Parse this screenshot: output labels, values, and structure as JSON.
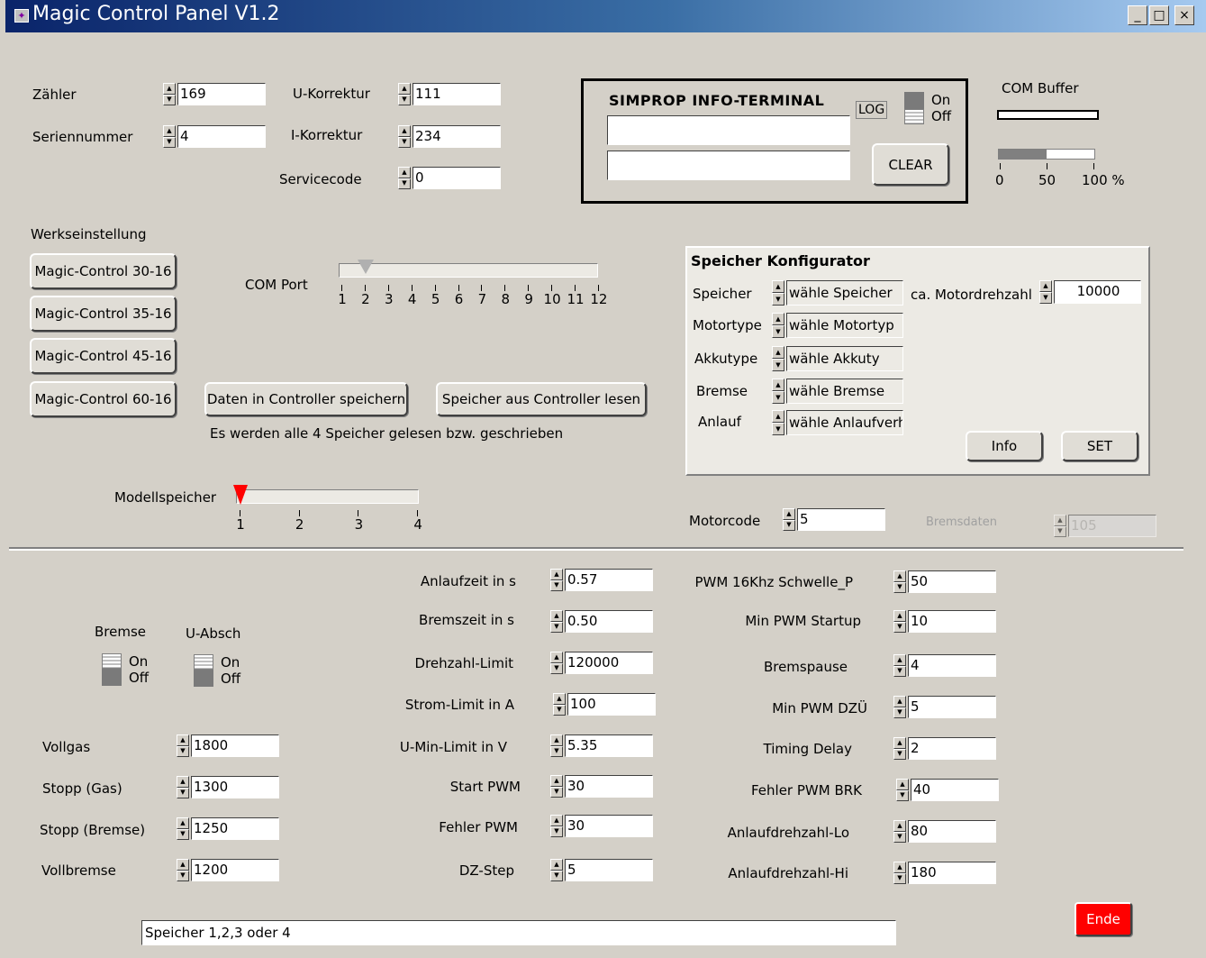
{
  "window": {
    "title": "Magic Control Panel V1.2",
    "minimize": "_",
    "maximize": "□",
    "close": "×"
  },
  "top_fields": {
    "zaehler": {
      "label": "Zähler",
      "value": "169"
    },
    "seriennummer": {
      "label": "Seriennummer",
      "value": "4"
    },
    "u_korrektur": {
      "label": "U-Korrektur",
      "value": "111"
    },
    "i_korrektur": {
      "label": "I-Korrektur",
      "value": "234"
    },
    "servicecode": {
      "label": "Servicecode",
      "value": "0"
    }
  },
  "terminal": {
    "title": "SIMPROP INFO-TERMINAL",
    "log_label": "LOG",
    "on": "On",
    "off": "Off",
    "clear": "CLEAR"
  },
  "com_buffer": {
    "label": "COM Buffer",
    "ticks": [
      "0",
      "50",
      "100 %"
    ],
    "level_percent": 50
  },
  "werkseinstellung": {
    "label": "Werkseinstellung",
    "buttons": [
      "Magic-Control 30-16",
      "Magic-Control 35-16",
      "Magic-Control 45-16",
      "Magic-Control 60-16"
    ]
  },
  "com_port": {
    "label": "COM Port",
    "ticks": [
      "1",
      "2",
      "3",
      "4",
      "5",
      "6",
      "7",
      "8",
      "9",
      "10",
      "11",
      "12"
    ],
    "value": 2
  },
  "actions": {
    "save": "Daten in Controller speichern",
    "read": "Speicher aus Controller lesen",
    "note": "Es werden alle 4 Speicher gelesen bzw. geschrieben"
  },
  "modellspeicher": {
    "label": "Modellspeicher",
    "ticks": [
      "1",
      "2",
      "3",
      "4"
    ],
    "value": 1
  },
  "speicher_konfigurator": {
    "title": "Speicher Konfigurator",
    "rows": [
      {
        "label": "Speicher",
        "value": "wähle Speicher"
      },
      {
        "label": "Motortype",
        "value": "wähle Motortyp"
      },
      {
        "label": "Akkutype",
        "value": "wähle Akkuty"
      },
      {
        "label": "Bremse",
        "value": "wähle Bremse"
      },
      {
        "label": "Anlauf",
        "value": "wähle Anlaufverh"
      }
    ],
    "motordrehzahl_label": "ca. Motordrehzahl",
    "motordrehzahl_value": "10000",
    "info": "Info",
    "set": "SET"
  },
  "motorcode": {
    "label": "Motorcode",
    "value": "5"
  },
  "bremsdaten": {
    "label": "Bremsdaten",
    "value": "105"
  },
  "toggles": {
    "bremse": {
      "label": "Bremse",
      "on": "On",
      "off": "Off"
    },
    "u_absch": {
      "label": "U-Absch",
      "on": "On",
      "off": "Off"
    }
  },
  "left_params": [
    {
      "label": "Vollgas",
      "value": "1800"
    },
    {
      "label": "Stopp (Gas)",
      "value": "1300"
    },
    {
      "label": "Stopp (Bremse)",
      "value": "1250"
    },
    {
      "label": "Vollbremse",
      "value": "1200"
    }
  ],
  "middle_params": [
    {
      "label": "Anlaufzeit  in s",
      "value": "0.57"
    },
    {
      "label": "Bremszeit in s",
      "value": "0.50"
    },
    {
      "label": "Drehzahl-Limit",
      "value": "120000"
    },
    {
      "label": "Strom-Limit in A",
      "value": "100"
    },
    {
      "label": "U-Min-Limit  in V",
      "value": "5.35"
    },
    {
      "label": "Start PWM",
      "value": "30"
    },
    {
      "label": "Fehler PWM",
      "value": "30"
    },
    {
      "label": "DZ-Step",
      "value": "5"
    }
  ],
  "right_params": [
    {
      "label": "PWM 16Khz Schwelle_P",
      "value": "50"
    },
    {
      "label": "Min PWM Startup",
      "value": "10"
    },
    {
      "label": "Bremspause",
      "value": "4"
    },
    {
      "label": "Min PWM DZÜ",
      "value": "5"
    },
    {
      "label": "Timing Delay",
      "value": "2"
    },
    {
      "label": "Fehler PWM BRK",
      "value": "40"
    },
    {
      "label": "Anlaufdrehzahl-Lo",
      "value": "80"
    },
    {
      "label": "Anlaufdrehzahl-Hi",
      "value": "180"
    }
  ],
  "status": {
    "text": "Speicher 1,2,3 oder 4"
  },
  "ende": {
    "label": "Ende",
    "color": "#ff0000"
  }
}
